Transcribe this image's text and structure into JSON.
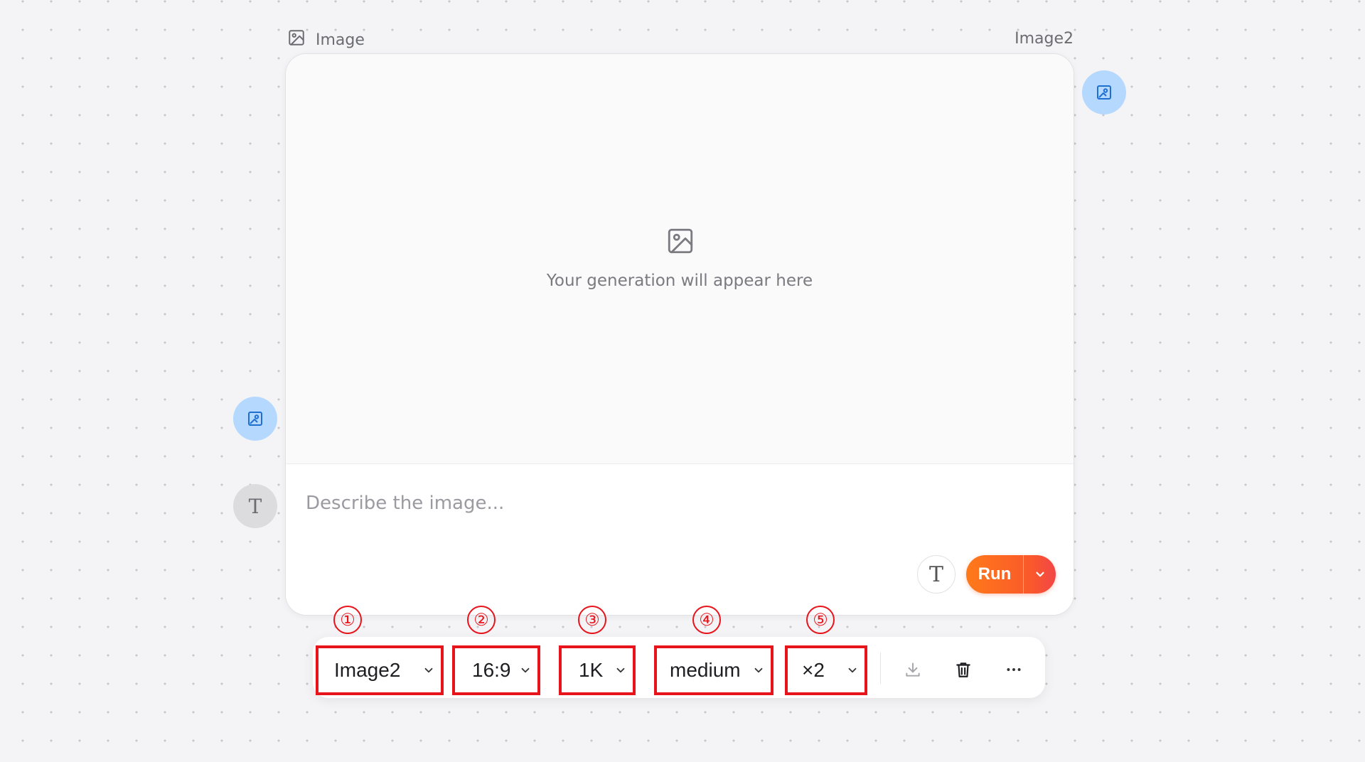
{
  "node": {
    "type_label": "Image",
    "model_label": "Image2"
  },
  "preview": {
    "placeholder_text": "Your generation will appear here"
  },
  "prompt": {
    "placeholder": "Describe the image...",
    "value": ""
  },
  "actions": {
    "text_mode_glyph": "T",
    "run_label": "Run"
  },
  "connectors": {
    "text_glyph": "T"
  },
  "toolbar": {
    "model": {
      "marker": "①",
      "value": "Image2"
    },
    "aspect_ratio": {
      "marker": "②",
      "value": "16:9"
    },
    "resolution": {
      "marker": "③",
      "value": "1K"
    },
    "quality": {
      "marker": "④",
      "value": "medium"
    },
    "count": {
      "marker": "⑤",
      "value": "×2"
    },
    "icons": [
      "download-icon",
      "trash-icon",
      "more-icon"
    ]
  },
  "colors": {
    "accent_run": "#fa5a2a",
    "annotation_red": "#e8141c",
    "connector_blue": "#b5d8ff",
    "connector_icon_blue": "#1f6fd1"
  }
}
